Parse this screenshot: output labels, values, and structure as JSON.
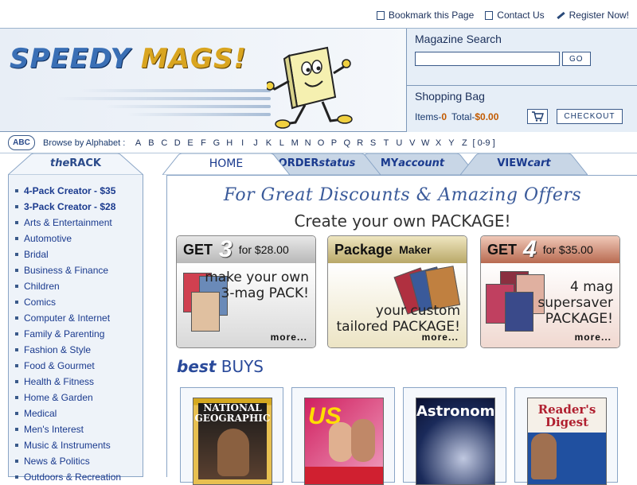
{
  "toplinks": [
    {
      "label": "Bookmark this Page"
    },
    {
      "label": "Contact Us"
    },
    {
      "label": "Register Now!"
    }
  ],
  "logo": {
    "part1": "SPEEDY",
    "part2": "MAGS!"
  },
  "search": {
    "title": "Magazine Search",
    "placeholder": "",
    "button": "GO"
  },
  "bag": {
    "title": "Shopping Bag",
    "items_label": "Items-",
    "items": "0",
    "total_label": "Total-",
    "total": "$0.00",
    "checkout": "CHECKOUT"
  },
  "alphabet": {
    "icon_text": "ABC",
    "label": "Browse by Alphabet :",
    "letters": [
      "A",
      "B",
      "C",
      "D",
      "E",
      "F",
      "G",
      "H",
      "I",
      "J",
      "K",
      "L",
      "M",
      "N",
      "O",
      "P",
      "Q",
      "R",
      "S",
      "T",
      "U",
      "V",
      "W",
      "X",
      "Y",
      "Z"
    ],
    "range": "[ 0-9 ]"
  },
  "rack": {
    "title_prefix": "the",
    "title": "RACK",
    "items": [
      {
        "label": "4-Pack Creator - $35"
      },
      {
        "label": "3-Pack Creator - $28"
      },
      {
        "label": "Arts & Entertainment"
      },
      {
        "label": "Automotive"
      },
      {
        "label": "Bridal"
      },
      {
        "label": "Business & Finance"
      },
      {
        "label": "Children"
      },
      {
        "label": "Comics"
      },
      {
        "label": "Computer & Internet"
      },
      {
        "label": "Family & Parenting"
      },
      {
        "label": "Fashion & Style"
      },
      {
        "label": "Food & Gourmet"
      },
      {
        "label": "Health & Fitness"
      },
      {
        "label": "Home & Garden"
      },
      {
        "label": "Medical"
      },
      {
        "label": "Men's Interest"
      },
      {
        "label": "Music & Instruments"
      },
      {
        "label": "News & Politics"
      },
      {
        "label": "Outdoors & Recreation"
      }
    ]
  },
  "tabs": [
    {
      "label": "HOME",
      "suffix": ""
    },
    {
      "label": "ORDER",
      "suffix": "status"
    },
    {
      "label": "MY",
      "suffix": "account"
    },
    {
      "label": "VIEW",
      "suffix": "cart"
    }
  ],
  "promo": {
    "headline": "For Great Discounts & Amazing Offers",
    "sub": "Create your own PACKAGE!"
  },
  "cards": [
    {
      "get": "GET",
      "num": "3",
      "price": "for $28.00",
      "line1": "make your own",
      "line2": "3-mag PACK!",
      "more": "more..."
    },
    {
      "get": "Package",
      "num": "",
      "price": "Maker",
      "line1": "your custom",
      "line2": "tailored PACKAGE!",
      "more": "more..."
    },
    {
      "get": "GET",
      "num": "4",
      "price": "for $35.00",
      "line1": "4 mag",
      "line2": "supersaver PACKAGE!",
      "more": "more..."
    }
  ],
  "best": {
    "prefix": "best",
    "word": "BUYS"
  },
  "magazines": [
    {
      "title": "NATIONAL GEOGRAPHIC"
    },
    {
      "title": "US"
    },
    {
      "title": "Astronomy"
    },
    {
      "title": "Reader's Digest"
    }
  ],
  "colors": {
    "accent": "#2a4a9a",
    "orange": "#c25a00",
    "panel": "#e6eef7"
  }
}
